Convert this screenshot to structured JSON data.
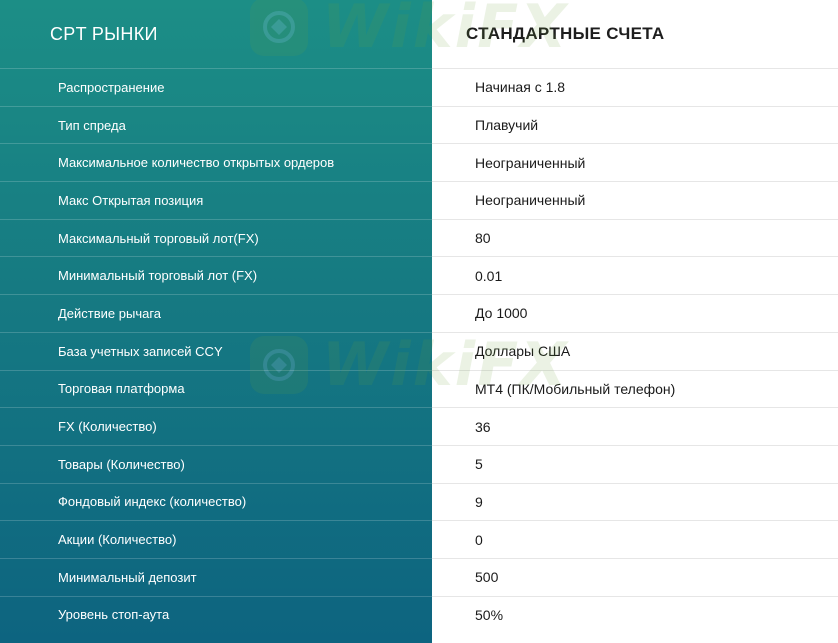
{
  "table": {
    "left_header": "CPT РЫНКИ",
    "right_header": "СТАНДАРТНЫЕ СЧЕТА",
    "rows": [
      {
        "label": "Распространение",
        "value": "Начиная с 1.8"
      },
      {
        "label": "Тип спреда",
        "value": "Плавучий"
      },
      {
        "label": "Максимальное количество открытых ордеров",
        "value": "Неограниченный"
      },
      {
        "label": "Макс Открытая позиция",
        "value": "Неограниченный"
      },
      {
        "label": "Максимальный торговый лот(FX)",
        "value": "80"
      },
      {
        "label": "Минимальный торговый лот (FX)",
        "value": "0.01"
      },
      {
        "label": "Действие рычага",
        "value": "До 1000"
      },
      {
        "label": "База учетных записей CCY",
        "value": "Доллары США"
      },
      {
        "label": "Торговая платформа",
        "value": "MT4 (ПК/Мобильный телефон)"
      },
      {
        "label": "FX (Количество)",
        "value": "36"
      },
      {
        "label": "Товары (Количество)",
        "value": "5"
      },
      {
        "label": "Фондовый индекс (количество)",
        "value": "9"
      },
      {
        "label": "Акции (Количество)",
        "value": "0"
      },
      {
        "label": "Минимальный депозит",
        "value": "500"
      },
      {
        "label": "Уровень стоп-аута",
        "value": "50%"
      }
    ]
  },
  "watermark": {
    "text": "WikiFX",
    "icon": "wikifx-logo-icon"
  },
  "colors": {
    "left_panel_top": "#1c8e86",
    "left_panel_bottom": "#0d6480",
    "watermark": "#6aa23a"
  }
}
